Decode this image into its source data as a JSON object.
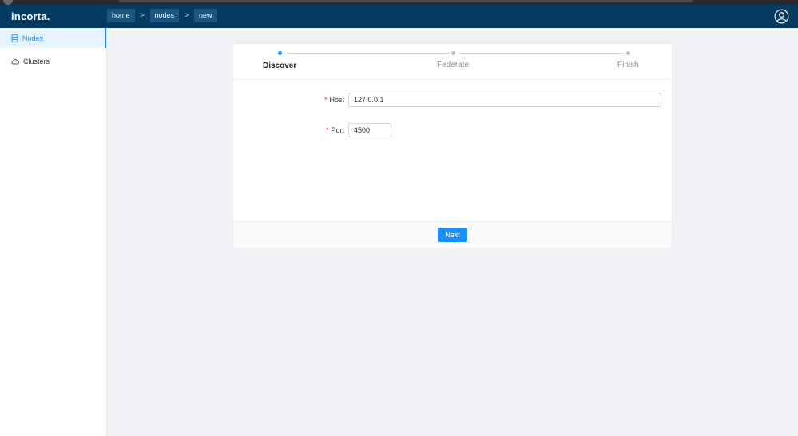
{
  "app": {
    "logo": "incorta."
  },
  "breadcrumb": [
    "home",
    "nodes",
    "new"
  ],
  "sidebar": {
    "items": [
      {
        "label": "Nodes",
        "icon": "database-icon",
        "active": true
      },
      {
        "label": "Clusters",
        "icon": "cloud-icon",
        "active": false
      }
    ]
  },
  "wizard": {
    "steps": [
      {
        "label": "Discover",
        "active": true
      },
      {
        "label": "Federate",
        "active": false
      },
      {
        "label": "Finish",
        "active": false
      }
    ]
  },
  "form": {
    "host": {
      "label": "Host",
      "value": "127.0.0.1"
    },
    "port": {
      "label": "Port",
      "value": "4500"
    }
  },
  "footer": {
    "next_label": "Next"
  },
  "colors": {
    "header": "#063b61",
    "accent": "#1890ff",
    "required": "#f5222d"
  }
}
